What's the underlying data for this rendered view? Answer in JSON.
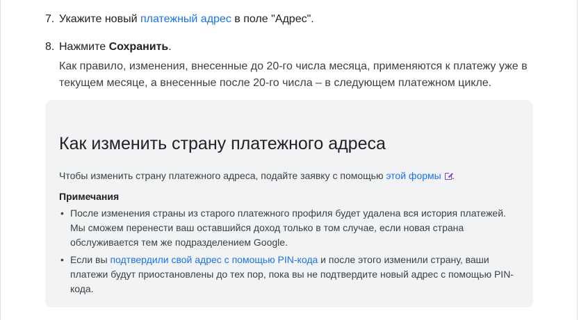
{
  "steps": {
    "step7": {
      "number": "7.",
      "text_before": "Укажите новый ",
      "link": "платежный адрес",
      "text_after": " в поле \"Адрес\"."
    },
    "step8": {
      "number": "8.",
      "text_before": "Нажмите ",
      "bold": "Сохранить",
      "text_after": ".",
      "paragraph": "Как правило, изменения, внесенные до 20-го числа месяца, применяются к платежу уже в текущем месяце, а внесенные после 20-го числа – в следующем платежном цикле."
    }
  },
  "callout": {
    "title": "Как изменить страну платежного адреса",
    "intro_before": "Чтобы изменить страну платежного адреса, подайте заявку с помощью ",
    "intro_link": "этой формы",
    "intro_after": ".",
    "external_icon": "open-in-new-icon",
    "notes_title": "Примечания",
    "notes": [
      {
        "bullet": "•",
        "text_before": "После изменения страны из старого платежного профиля будет удалена вся история платежей. Мы сможем перенести ваш оставшийся доход только в том случае, если новая страна обслуживается тем же подразделением Google.",
        "link": "",
        "text_after": ""
      },
      {
        "bullet": "•",
        "text_before": "Если вы ",
        "link": "подтвердили свой адрес с помощью PIN-кода",
        "text_after": " и после этого изменили страну, ваши платежи будут приостановлены до тех пор, пока вы не подтвердите новый адрес с помощью PIN-кода."
      }
    ]
  },
  "colors": {
    "link": "#1a73e8",
    "visited_link": "#7b3fc0",
    "callout_bg": "#f1f3f4",
    "text": "#202124"
  }
}
